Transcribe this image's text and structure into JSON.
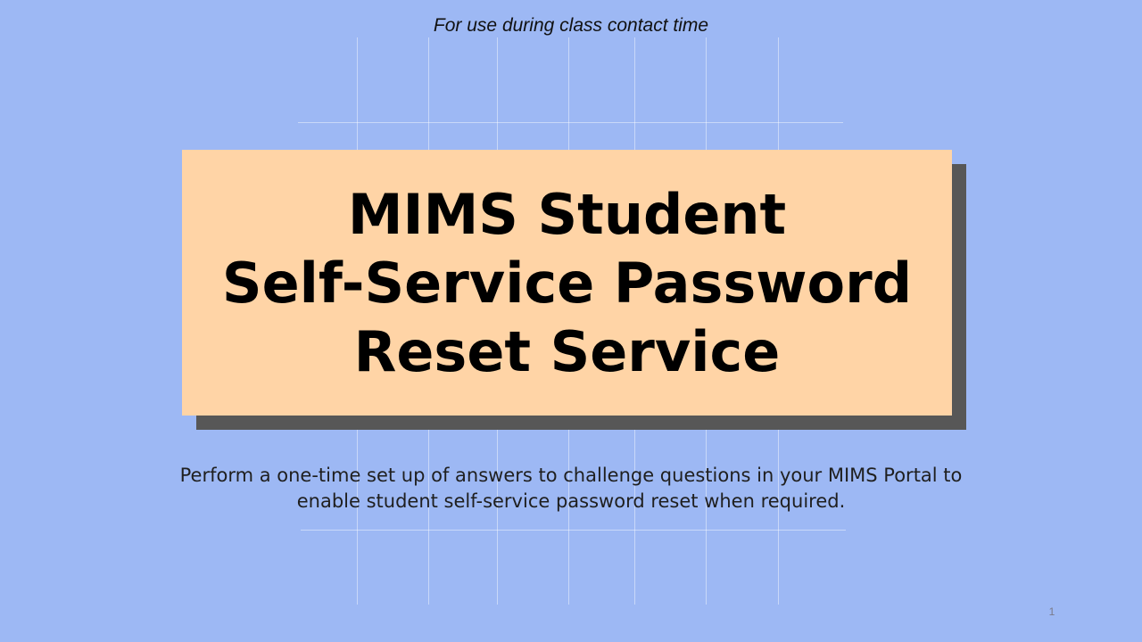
{
  "slide": {
    "top_note": "For use during class contact time",
    "title_lines": [
      "MIMS Student",
      "Self-Service Password",
      "Reset Service"
    ],
    "subtitle_line1": "Perform a one-time set up of answers to challenge questions in your MIMS Portal to",
    "subtitle_line2": "enable student self-service password reset when required.",
    "page_number": "1"
  },
  "colors": {
    "background": "#9db8f4",
    "title_box": "#ffd4a6",
    "title_shadow": "#575757"
  }
}
